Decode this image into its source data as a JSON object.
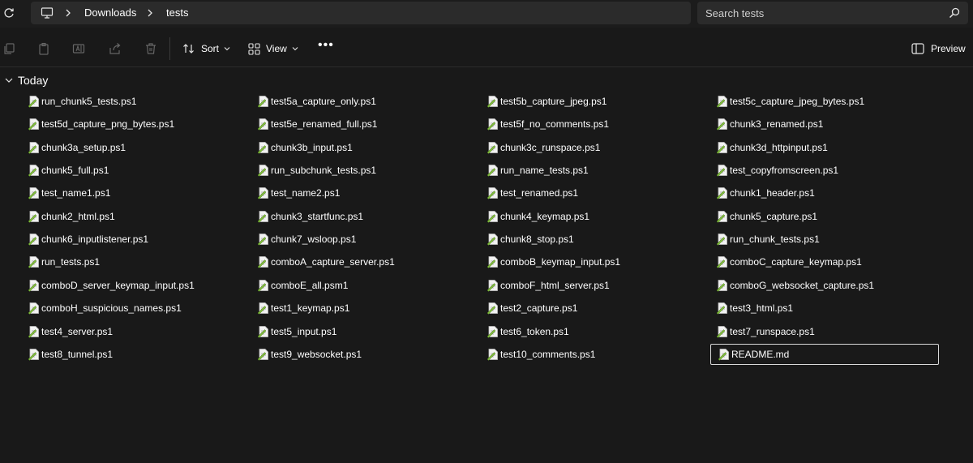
{
  "breadcrumb": {
    "items": [
      "Downloads",
      "tests"
    ]
  },
  "search": {
    "placeholder": "Search tests"
  },
  "toolbar": {
    "sort_label": "Sort",
    "view_label": "View",
    "more_label": "•••",
    "preview_label": "Preview"
  },
  "group": {
    "label": "Today"
  },
  "files": [
    "run_chunk5_tests.ps1",
    "test5a_capture_only.ps1",
    "test5b_capture_jpeg.ps1",
    "test5c_capture_jpeg_bytes.ps1",
    "test5d_capture_png_bytes.ps1",
    "test5e_renamed_full.ps1",
    "test5f_no_comments.ps1",
    "chunk3_renamed.ps1",
    "chunk3a_setup.ps1",
    "chunk3b_input.ps1",
    "chunk3c_runspace.ps1",
    "chunk3d_httpinput.ps1",
    "chunk5_full.ps1",
    "run_subchunk_tests.ps1",
    "run_name_tests.ps1",
    "test_copyfromscreen.ps1",
    "test_name1.ps1",
    "test_name2.ps1",
    "test_renamed.ps1",
    "chunk1_header.ps1",
    "chunk2_html.ps1",
    "chunk3_startfunc.ps1",
    "chunk4_keymap.ps1",
    "chunk5_capture.ps1",
    "chunk6_inputlistener.ps1",
    "chunk7_wsloop.ps1",
    "chunk8_stop.ps1",
    "run_chunk_tests.ps1",
    "run_tests.ps1",
    "comboA_capture_server.ps1",
    "comboB_keymap_input.ps1",
    "comboC_capture_keymap.ps1",
    "comboD_server_keymap_input.ps1",
    "comboE_all.psm1",
    "comboF_html_server.ps1",
    "comboG_websocket_capture.ps1",
    "comboH_suspicious_names.ps1",
    "test1_keymap.ps1",
    "test2_capture.ps1",
    "test3_html.ps1",
    "test4_server.ps1",
    "test5_input.ps1",
    "test6_token.ps1",
    "test7_runspace.ps1",
    "test8_tunnel.ps1",
    "test9_websocket.ps1",
    "test10_comments.ps1",
    "README.md"
  ],
  "selected_file": "README.md",
  "colors": {
    "background": "#191919",
    "bar": "#2b2b2b",
    "file_icon_green": "#7fba3c"
  }
}
